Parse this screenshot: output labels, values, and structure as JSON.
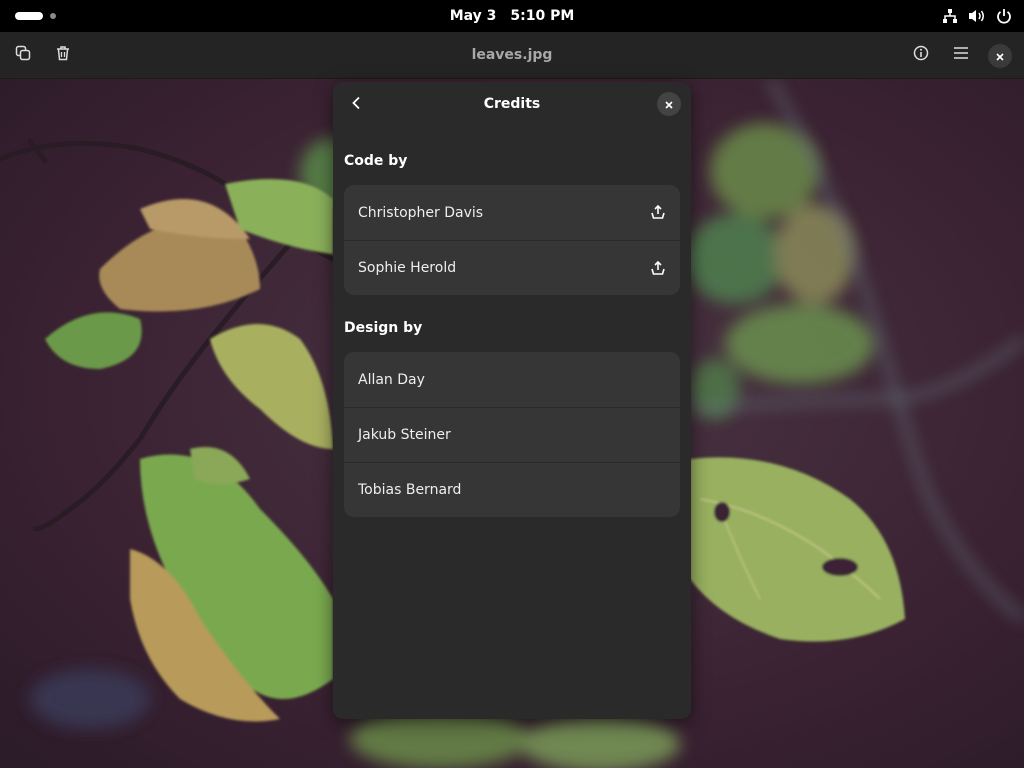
{
  "topbar": {
    "date": "May 3",
    "time": "5:10 PM"
  },
  "header": {
    "title": "leaves.jpg"
  },
  "dialog": {
    "title": "Credits",
    "code_section": {
      "heading": "Code by",
      "people": [
        {
          "name": "Christopher Davis"
        },
        {
          "name": "Sophie Herold"
        }
      ]
    },
    "design_section": {
      "heading": "Design by",
      "people": [
        {
          "name": "Allan Day"
        },
        {
          "name": "Jakub Steiner"
        },
        {
          "name": "Tobias Bernard"
        }
      ]
    }
  },
  "icons": {
    "topbar": [
      "activities-pill",
      "workspace-dot",
      "network-icon",
      "volume-icon",
      "power-icon"
    ],
    "header": [
      "copy-icon",
      "trash-icon",
      "info-icon",
      "menu-icon",
      "close-icon"
    ],
    "dialog": [
      "back-icon",
      "close-icon",
      "external-link-icon"
    ]
  },
  "colors": {
    "header_bg": "#242424",
    "dialog_bg": "#2a2a2a",
    "row_bg": "#363636",
    "topbar_bg": "#000000"
  }
}
